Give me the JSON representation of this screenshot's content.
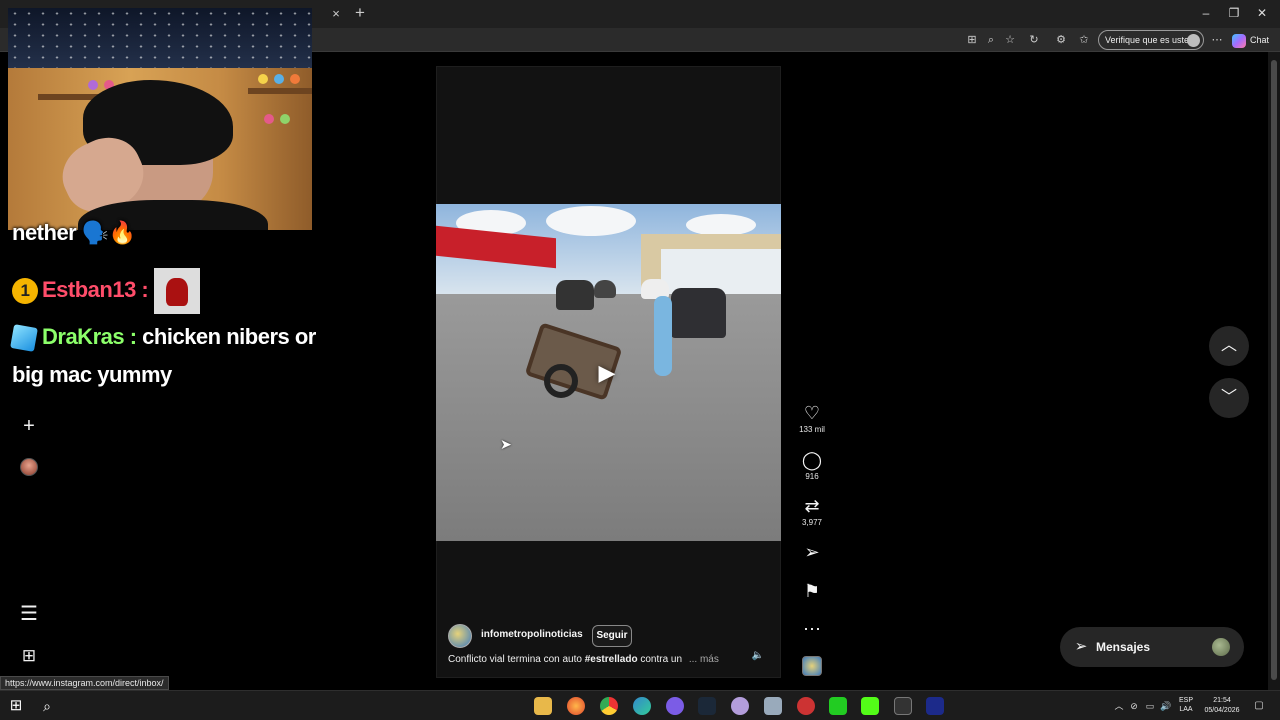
{
  "browser": {
    "tab_close": "×",
    "new_tab": "+",
    "window_minimize": "–",
    "window_restore": "❐",
    "window_close": "✕",
    "verify_label": "Verifique que es usted",
    "chat_label": "Chat"
  },
  "status_url": "https://www.instagram.com/direct/inbox/",
  "stream_chat": {
    "lines": [
      {
        "text": "nether 🗣️🔥"
      },
      {
        "badge": "1",
        "user": "Estban13 :",
        "user_color": "#ff4d6a"
      },
      {
        "user": "DraKras :",
        "user_color": "#8cff6a",
        "message": "chicken nibers or"
      },
      {
        "message": "big mac yummy"
      }
    ]
  },
  "reel": {
    "username": "infometropolinoticias",
    "follow_label": "Seguir",
    "caption_text": "Conflicto vial termina con auto",
    "caption_hashtag": "#estrellado",
    "caption_tail": "contra un",
    "caption_more": "... más",
    "actions": {
      "likes": "133 mil",
      "comments": "916",
      "reposts": "3,977"
    }
  },
  "messages": {
    "label": "Mensajes"
  },
  "taskbar": {
    "lang_line1": "ESP",
    "lang_line2": "LAA",
    "time": "21:54",
    "date": "05/04/2026"
  },
  "colors": {
    "background": "#000000",
    "panel": "#262626",
    "accent_red": "#c8202a"
  }
}
